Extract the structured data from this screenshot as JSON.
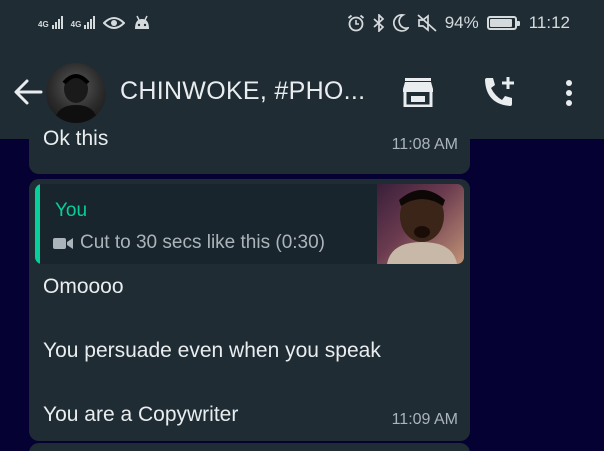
{
  "status_bar": {
    "network_1": "4G",
    "network_2": "4G",
    "battery_percent": "94%",
    "battery_level": 0.94,
    "time": "11:12",
    "icons": [
      "signal-icon",
      "eye-icon",
      "android-icon",
      "alarm-icon",
      "bluetooth-icon",
      "moon-icon",
      "mute-icon",
      "battery-icon"
    ]
  },
  "header": {
    "chat_title": "CHINWOKE, #PHO...",
    "icons": [
      "back-arrow-icon",
      "store-icon",
      "add-call-icon",
      "more-vert-icon"
    ]
  },
  "messages": [
    {
      "text": "Ok this",
      "time": "11:08 AM"
    },
    {
      "quote": {
        "author": "You",
        "text": "Cut to 30 secs like this (0:30)",
        "media_icon": "video-camera-icon"
      },
      "lines": [
        "Omoooo",
        "You persuade even when you speak",
        "You are a Copywriter"
      ],
      "time": "11:09 AM"
    }
  ],
  "colors": {
    "background": "#050233",
    "bar": "#1f2c34",
    "bubble": "#1f2c34",
    "quote_bg": "#19252c",
    "accent": "#06cf9c"
  }
}
